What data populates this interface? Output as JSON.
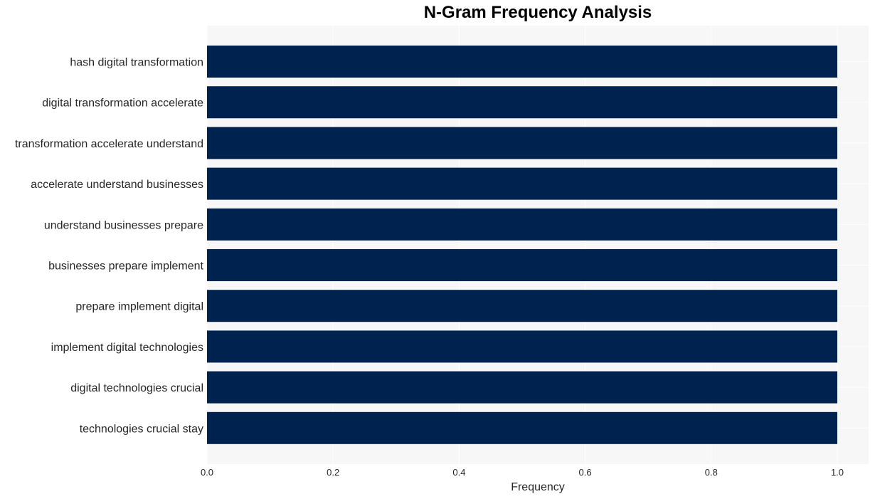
{
  "chart_data": {
    "type": "bar",
    "orientation": "horizontal",
    "title": "N-Gram Frequency Analysis",
    "xlabel": "Frequency",
    "ylabel": "",
    "categories": [
      "hash digital transformation",
      "digital transformation accelerate",
      "transformation accelerate understand",
      "accelerate understand businesses",
      "understand businesses prepare",
      "businesses prepare implement",
      "prepare implement digital",
      "implement digital technologies",
      "digital technologies crucial",
      "technologies crucial stay"
    ],
    "values": [
      1,
      1,
      1,
      1,
      1,
      1,
      1,
      1,
      1,
      1
    ],
    "xlim": [
      0,
      1.05
    ],
    "xticks": [
      0.0,
      0.2,
      0.4,
      0.6,
      0.8,
      1.0
    ],
    "xtick_labels": [
      "0.0",
      "0.2",
      "0.4",
      "0.6",
      "0.8",
      "1.0"
    ],
    "grid": true,
    "legend": "none",
    "colors": {
      "bar": "#00224e",
      "plot_background": "#f7f7f7",
      "grid": "#ffffff",
      "text": "#262626"
    }
  }
}
